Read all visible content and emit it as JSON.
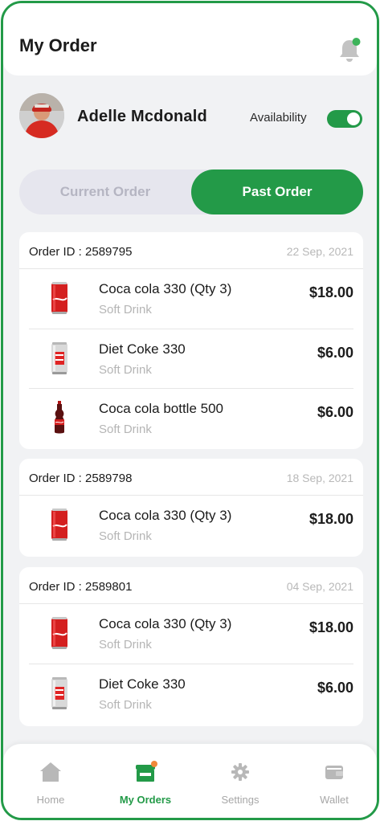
{
  "header": {
    "title": "My Order",
    "notification_icon": "bell-icon",
    "notification_dot_color": "#3db35a"
  },
  "profile": {
    "name": "Adelle Mcdonald",
    "availability_label": "Availability",
    "availability_on": true
  },
  "tabs": {
    "current": "Current Order",
    "past": "Past Order",
    "selected": "past"
  },
  "orders": [
    {
      "id_label": "Order ID : 2589795",
      "date": "22 Sep, 2021",
      "items": [
        {
          "name": "Coca cola 330 (Qty 3)",
          "category": "Soft Drink",
          "price": "$18.00",
          "icon": "coca-cola-can-icon"
        },
        {
          "name": "Diet Coke 330",
          "category": "Soft Drink",
          "price": "$6.00",
          "icon": "diet-coke-can-icon"
        },
        {
          "name": "Coca cola bottle 500",
          "category": "Soft Drink",
          "price": "$6.00",
          "icon": "coca-cola-bottle-icon"
        }
      ]
    },
    {
      "id_label": "Order ID : 2589798",
      "date": "18 Sep, 2021",
      "items": [
        {
          "name": "Coca cola 330 (Qty 3)",
          "category": "Soft Drink",
          "price": "$18.00",
          "icon": "coca-cola-can-icon"
        }
      ]
    },
    {
      "id_label": "Order ID : 2589801",
      "date": "04 Sep, 2021",
      "items": [
        {
          "name": "Coca cola 330 (Qty 3)",
          "category": "Soft Drink",
          "price": "$18.00",
          "icon": "coca-cola-can-icon"
        },
        {
          "name": "Diet Coke 330",
          "category": "Soft Drink",
          "price": "$6.00",
          "icon": "diet-coke-can-icon"
        }
      ]
    }
  ],
  "nav": {
    "home": "Home",
    "orders": "My Orders",
    "settings": "Settings",
    "wallet": "Wallet",
    "active": "orders"
  },
  "colors": {
    "accent": "#239a48",
    "badge": "#f0883a"
  }
}
